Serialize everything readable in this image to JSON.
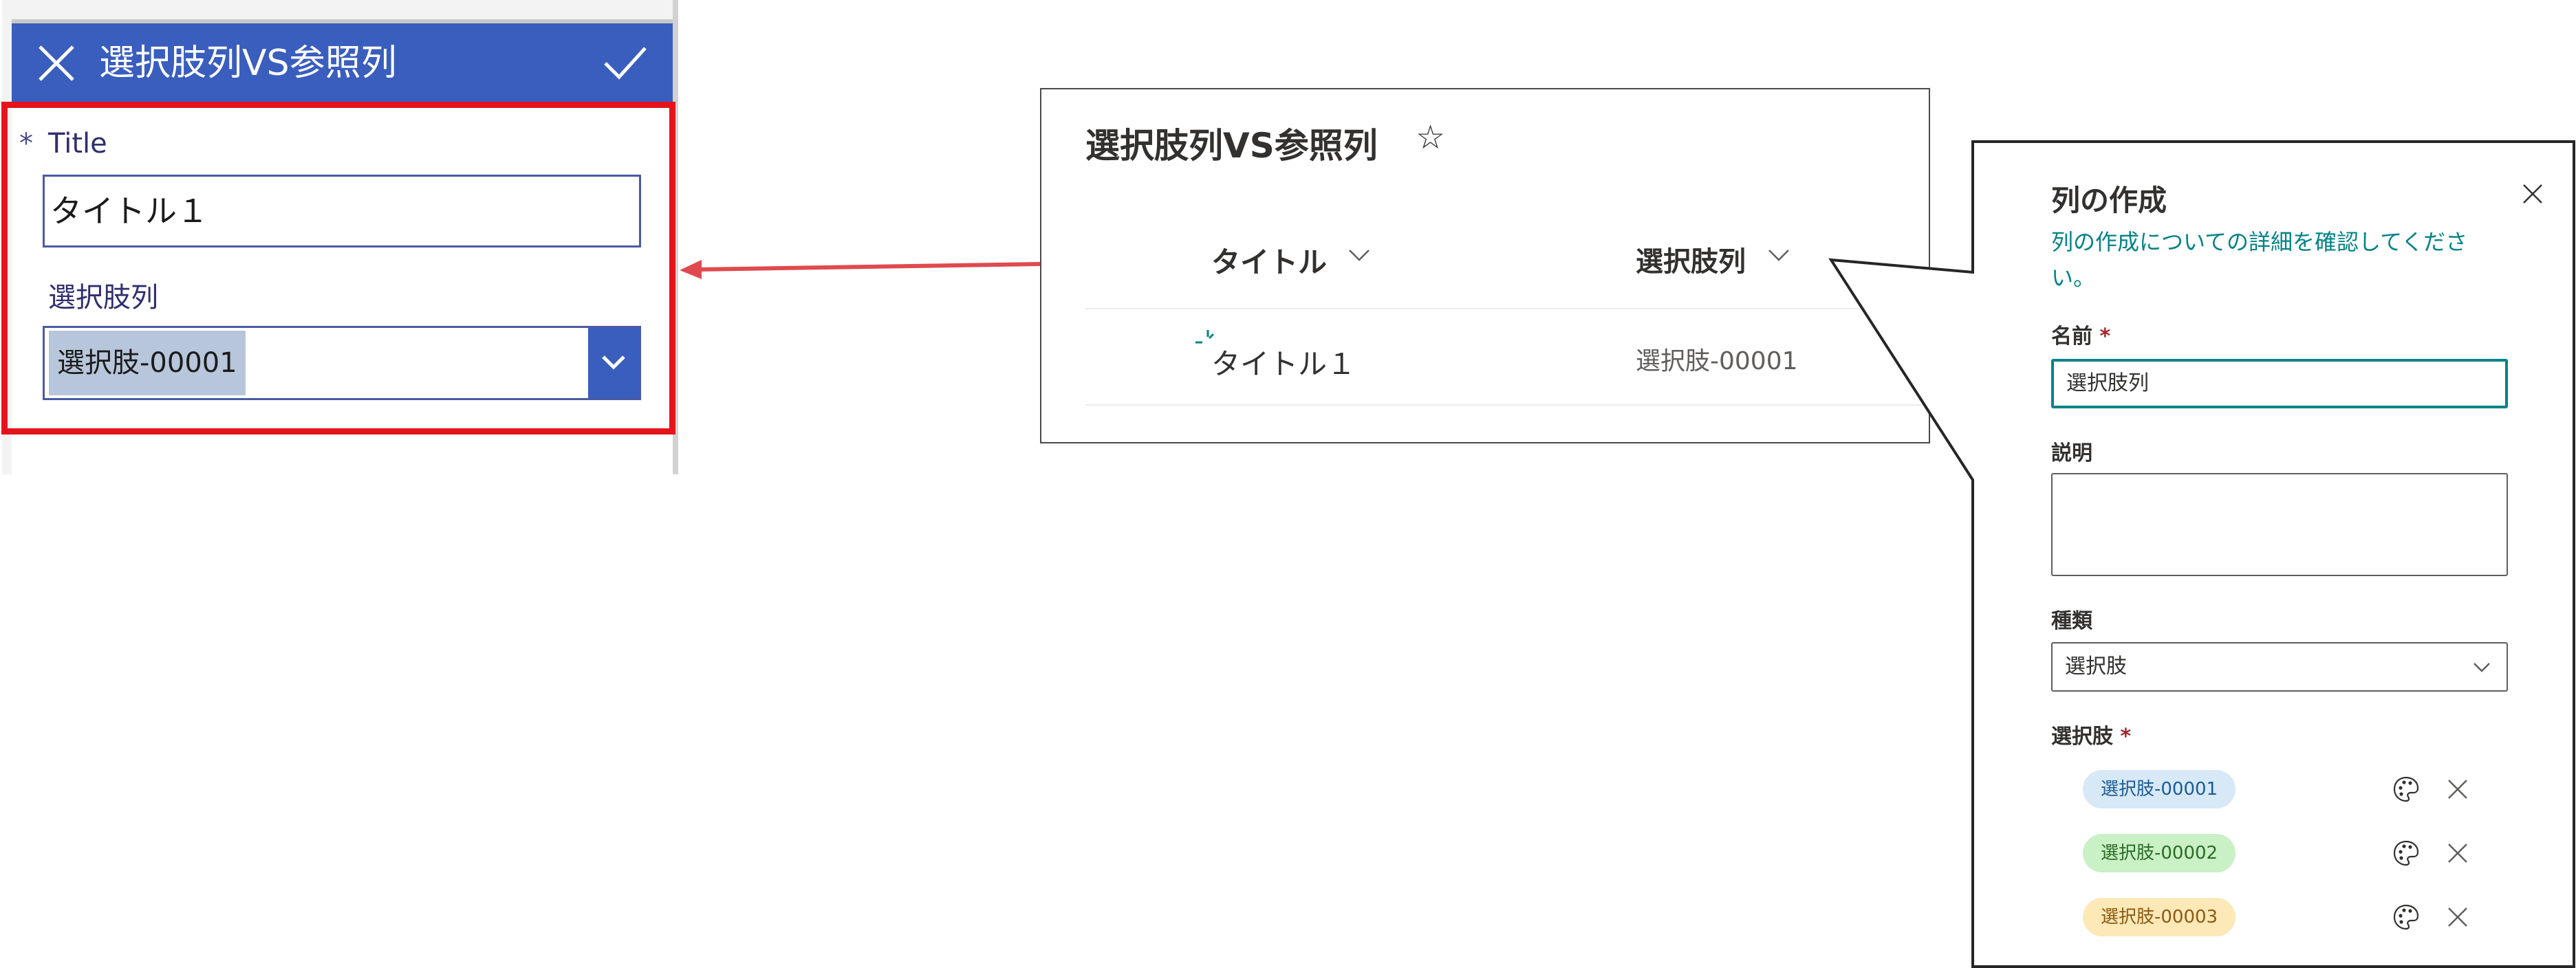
{
  "power_apps_form": {
    "header_title": "選択肢列VS参照列",
    "required_marker": "*",
    "title_label": "Title",
    "title_value": "タイトル１",
    "choice_label": "選択肢列",
    "choice_value": "選択肢-00001",
    "header_color": "#3a5ebd",
    "highlight_color": "#e5141c"
  },
  "sharepoint_list": {
    "title": "選択肢列VS参照列",
    "favorite_icon": "☆",
    "columns": [
      "タイトル",
      "選択肢列"
    ],
    "rows": [
      {
        "title": "タイトル１",
        "choice": "選択肢-00001"
      }
    ]
  },
  "create_column_panel": {
    "title": "列の作成",
    "learn_more_link": "列の作成についての詳細を確認してください。",
    "name_label": "名前",
    "required_marker": "*",
    "name_value": "選択肢列",
    "description_label": "説明",
    "description_value": "",
    "type_label": "種類",
    "type_value": "選択肢",
    "choices_label": "選択肢",
    "choices": [
      {
        "label": "選択肢-00001",
        "bg": "#d7e8f7",
        "fg": "#1c5c94"
      },
      {
        "label": "選択肢-00002",
        "bg": "#caf0c6",
        "fg": "#2b6b27"
      },
      {
        "label": "選択肢-00003",
        "bg": "#fde8b8",
        "fg": "#8a5a10"
      }
    ],
    "accent_color": "#038387"
  }
}
